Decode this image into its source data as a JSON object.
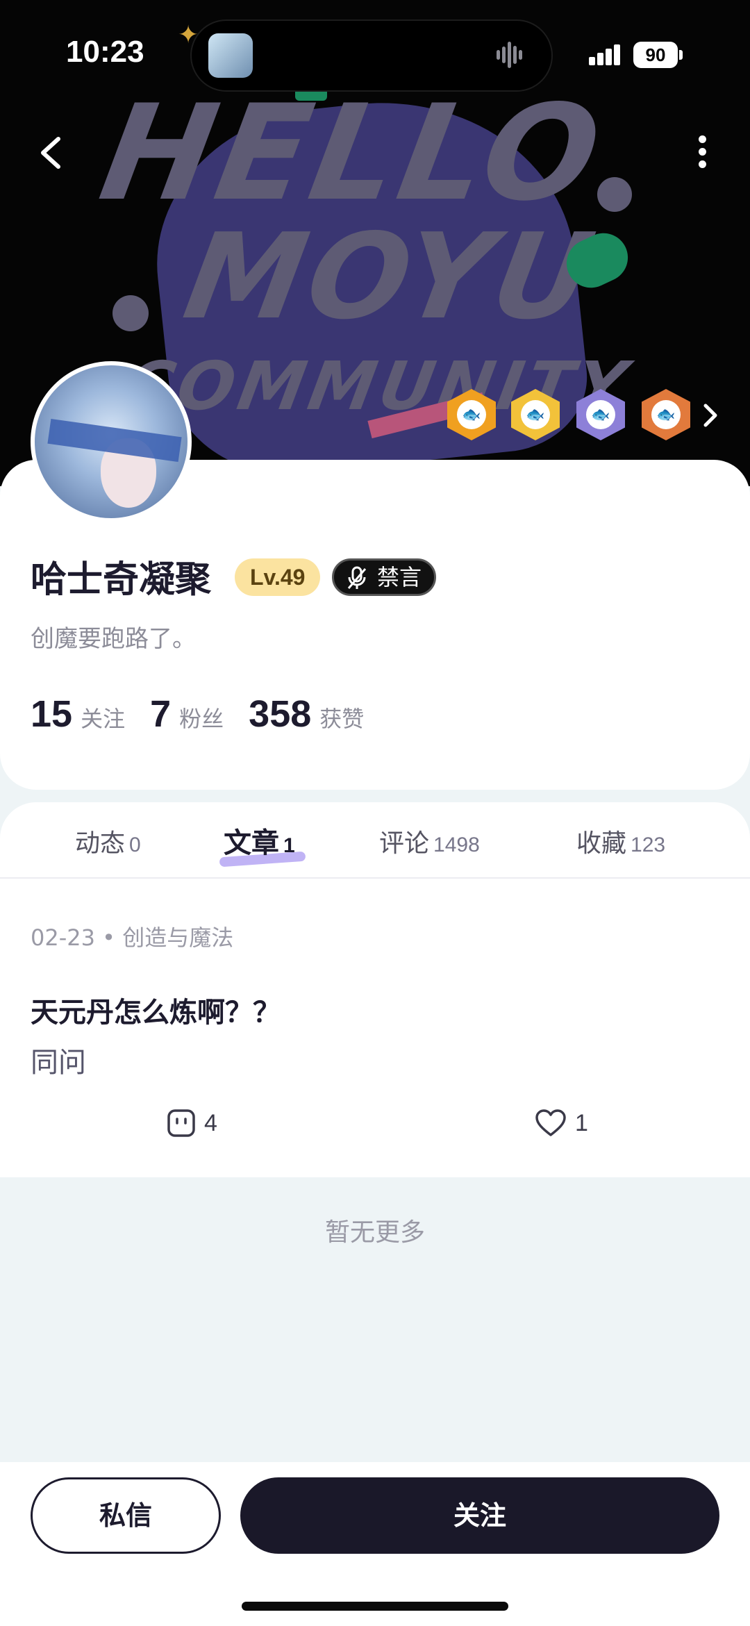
{
  "status_bar": {
    "time": "10:23",
    "battery": "90"
  },
  "banner": {
    "line1": "HELLO",
    "line2": "MOYU",
    "line3": "COMMUNITY"
  },
  "badges": [
    {
      "name": "badge-gold-fish",
      "color": "#f0a020"
    },
    {
      "name": "badge-gold-star",
      "color": "#f2c23a"
    },
    {
      "name": "badge-purple",
      "color": "#8d80d8"
    },
    {
      "name": "badge-orange",
      "color": "#e27a3c"
    }
  ],
  "profile": {
    "username": "哈士奇凝聚",
    "level": "Lv.49",
    "mute_label": "禁言",
    "bio": "创魔要跑路了。",
    "stats": [
      {
        "value": "15",
        "label": "关注"
      },
      {
        "value": "7",
        "label": "粉丝"
      },
      {
        "value": "358",
        "label": "获赞"
      }
    ]
  },
  "tabs": [
    {
      "label": "动态",
      "count": "0"
    },
    {
      "label": "文章",
      "count": "1",
      "active": true
    },
    {
      "label": "评论",
      "count": "1498"
    },
    {
      "label": "收藏",
      "count": "123"
    }
  ],
  "post": {
    "meta": "02-23 • 创造与魔法",
    "title": "天元丹怎么炼啊？？",
    "body": "同问",
    "comments": "4",
    "likes": "1"
  },
  "footer_note": "暂无更多",
  "actions": {
    "message": "私信",
    "follow": "关注"
  }
}
